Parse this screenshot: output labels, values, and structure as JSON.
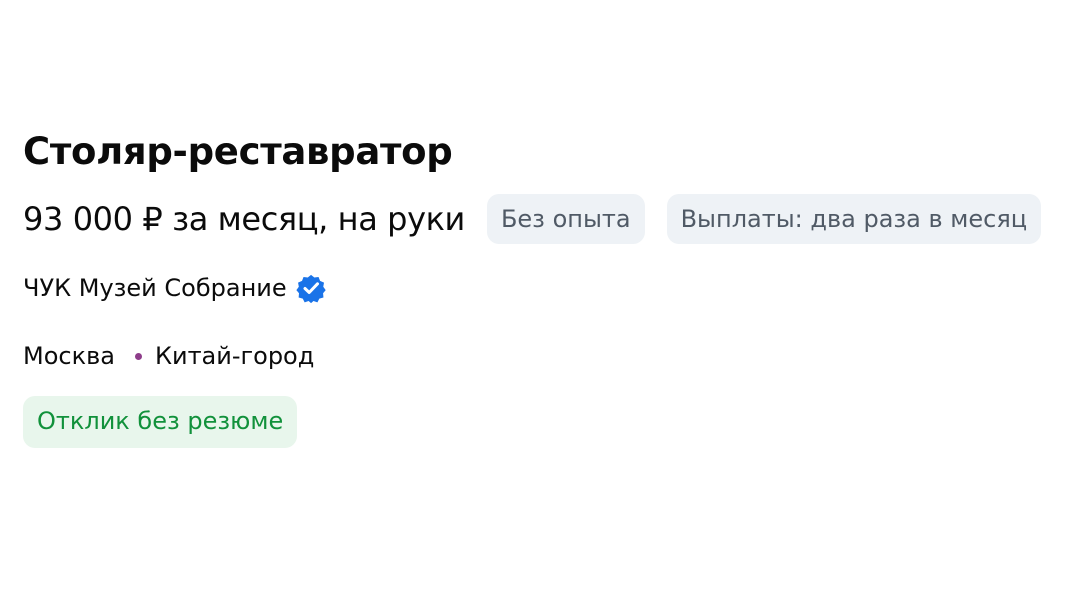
{
  "vacancy": {
    "title": "Столяр-реставратор",
    "salary": "93 000 ₽ за месяц, на руки",
    "tags": [
      "Без опыта",
      "Выплаты: два раза в месяц"
    ],
    "company": {
      "name": "ЧУК Музей Собрание",
      "verified_icon": "verified-badge-icon"
    },
    "location": {
      "city": "Москва",
      "metro_station": "Китай-город",
      "metro_color": "#8e3d8a"
    },
    "respond_button": "Отклик без резюме"
  },
  "colors": {
    "verified": "#1a73e8",
    "respond_text": "#11913b",
    "respond_bg": "#e8f6ec"
  }
}
